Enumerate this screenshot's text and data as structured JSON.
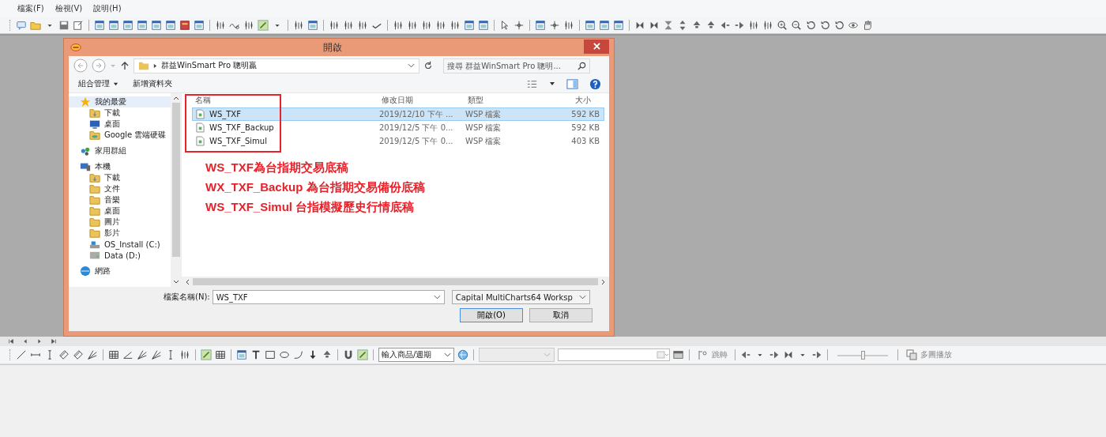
{
  "menu": [
    {
      "label": "檔案(F)"
    },
    {
      "label": "檢視(V)"
    },
    {
      "label": "說明(H)"
    }
  ],
  "dialog": {
    "title": "開啟",
    "address": "群益WinSmart Pro 聰明贏",
    "search": {
      "placeholder": "搜尋 群益WinSmart Pro 聰明..."
    },
    "commands": [
      {
        "label": "組合管理",
        "dropdown": true
      },
      {
        "label": "新增資料夾",
        "dropdown": false
      }
    ],
    "sidebar": [
      {
        "label": "我的最愛",
        "kind": "star",
        "selected": true,
        "children": [
          {
            "label": "下載",
            "kind": "download",
            "selected": false
          },
          {
            "label": "桌面",
            "kind": "monitor",
            "selected": false
          },
          {
            "label": "Google 雲端硬碟",
            "kind": "cloud",
            "selected": false
          }
        ]
      },
      {
        "label": "家用群組",
        "kind": "group",
        "selected": false
      },
      {
        "label": "本機",
        "kind": "computer",
        "selected": false,
        "children": [
          {
            "label": "下載",
            "kind": "download",
            "selected": false
          },
          {
            "label": "文件",
            "kind": "folder",
            "selected": false
          },
          {
            "label": "音樂",
            "kind": "folder",
            "selected": false
          },
          {
            "label": "桌面",
            "kind": "folder",
            "selected": false
          },
          {
            "label": "圖片",
            "kind": "folder",
            "selected": false
          },
          {
            "label": "影片",
            "kind": "folder",
            "selected": false
          },
          {
            "label": "OS_Install (C:)",
            "kind": "drive",
            "selected": false
          },
          {
            "label": "Data (D:)",
            "kind": "disk",
            "selected": false
          }
        ]
      },
      {
        "label": "網路",
        "kind": "network",
        "selected": false
      }
    ],
    "columns": [
      "名稱",
      "修改日期",
      "類型",
      "大小"
    ],
    "files": [
      {
        "name": "WS_TXF",
        "modified": "2019/12/10 下午 ...",
        "type": "WSP 檔案",
        "size": "592 KB",
        "selected": true
      },
      {
        "name": "WS_TXF_Backup",
        "modified": "2019/12/5 下午 0...",
        "type": "WSP 檔案",
        "size": "592 KB",
        "selected": false
      },
      {
        "name": "WS_TXF_Simul",
        "modified": "2019/12/5 下午 0...",
        "type": "WSP 檔案",
        "size": "403 KB",
        "selected": false
      }
    ],
    "annotations": [
      "WS_TXF為台指期交易底稿",
      "WX_TXF_Backup 為台指期交易備份底稿",
      "WS_TXF_Simul 台指模擬歷史行情底稿"
    ],
    "filename_label": "檔案名稱(N):",
    "filename": "WS_TXF",
    "filetype": "Capital MultiCharts64 Worksp",
    "buttons": [
      "開啟(O)",
      "取消"
    ]
  },
  "bottom_toolbar": {
    "symbol_combo": "輸入商品/週期",
    "jump": {
      "label": "跳轉",
      "disabled": true
    },
    "replay_slider": {
      "level": 0.5
    },
    "multi_play": {
      "label": "多圖播放",
      "disabled": true
    }
  }
}
